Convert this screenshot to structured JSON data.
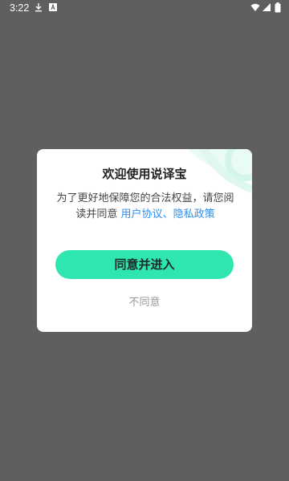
{
  "status_bar": {
    "time": "3:22",
    "icons": [
      "download-icon",
      "app-a-icon",
      "wifi-icon",
      "cellular-icon",
      "battery-icon"
    ]
  },
  "dialog": {
    "title": "欢迎使用说译宝",
    "message_prefix": "为了更好地保障您的合法权益，请您阅读并同意 ",
    "link_user_agreement": "用户协议",
    "separator": "、",
    "link_privacy_policy": "隐私政策",
    "agree_button": "同意并进入",
    "disagree_button": "不同意"
  },
  "colors": {
    "backdrop": "#5f5f5f",
    "accent": "#2fe6b0",
    "link": "#2a8ef0"
  }
}
